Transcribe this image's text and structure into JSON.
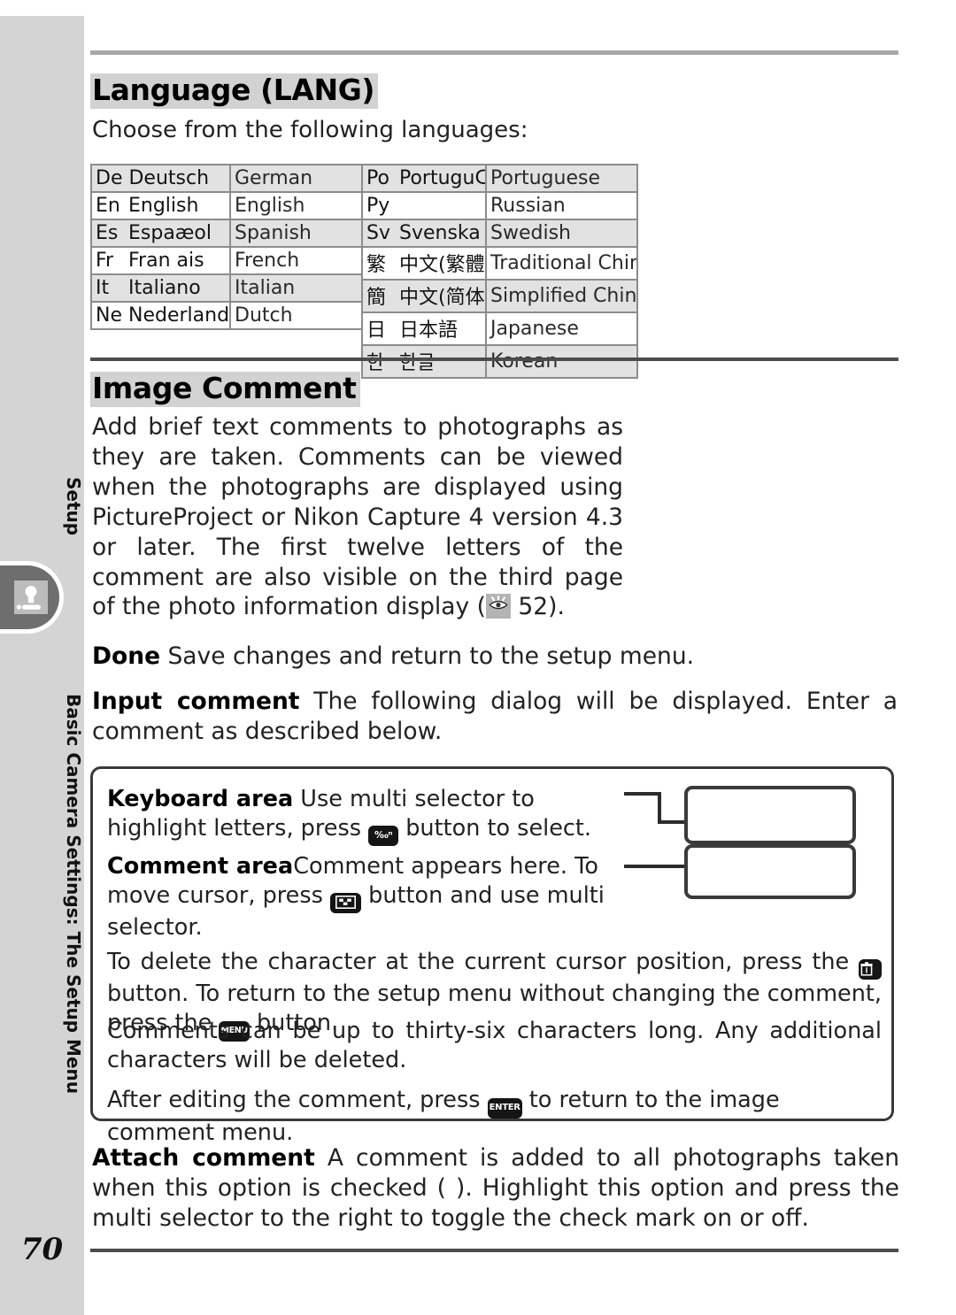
{
  "sidebar": {
    "setup_label": "Setup",
    "chapter_label": "Basic Camera Settings: The Setup Menu",
    "page_number": "70"
  },
  "sections": {
    "language": {
      "title": "Language (LANG)",
      "lead": "Choose from the following languages:",
      "table_left": [
        {
          "code": "De",
          "native": "Deutsch",
          "english": "German"
        },
        {
          "code": "En",
          "native": "English",
          "english": "English"
        },
        {
          "code": "Es",
          "native": "Espaæol",
          "english": "Spanish"
        },
        {
          "code": "Fr",
          "native": "Fran ais",
          "english": "French"
        },
        {
          "code": "It",
          "native": "Italiano",
          "english": "Italian"
        },
        {
          "code": "Ne",
          "native": "Nederlands",
          "english": "Dutch"
        }
      ],
      "table_right": [
        {
          "code": "Po",
          "native": "PortuguŒEs",
          "english": "Portuguese"
        },
        {
          "code": "Py",
          "native": "",
          "english": "Russian"
        },
        {
          "code": "Sv",
          "native": "Svenska",
          "english": "Swedish"
        },
        {
          "code": "繁",
          "native": "中文(繁體)",
          "english": "Traditional Chinese"
        },
        {
          "code": "簡",
          "native": "中文(简体)",
          "english": "Simplified Chinese"
        },
        {
          "code": "日",
          "native": "日本語",
          "english": "Japanese"
        },
        {
          "code": "한",
          "native": "한글",
          "english": "Korean"
        }
      ]
    },
    "image_comment": {
      "title": "Image Comment",
      "body_pre": "Add brief text comments to photographs as they are taken.  Comments can be viewed when the photographs are displayed using PictureProject or Nikon Capture 4 version 4.3 or later.  The first twelve letters of the comment are also visible on the third page of the photo information display (",
      "body_post": " 52).",
      "done_label": "Done",
      "done_text": " Save changes and return to the setup menu.",
      "input_label": "Input comment",
      "input_text": " The following dialog will be displayed.  Enter a comment as described below.",
      "attach_label": "Attach comment",
      "attach_text": " A comment is added to all photographs taken when this option is checked (   ).  Highlight this option and press the multi selector to the right to toggle the check mark on or off."
    },
    "callout": {
      "keyboard_label": "Keyboard area",
      "keyboard_text_pre": " Use multi selector to highlight letters, press ",
      "keyboard_text_post": " button to select.",
      "comment_label": "Comment area",
      "comment_text_pre": "Comment appears here.  To move cursor, press ",
      "comment_text_post": " button and use multi selector.",
      "delete_text_pre": "To delete the character at the current cursor position, press the ",
      "delete_text_mid": " button.  To return to the setup menu without changing the comment, press the ",
      "delete_text_post": " button.",
      "length_text": "Comments can be up to thirty-six characters long.  Any additional characters will be deleted.",
      "after_text_pre": "After editing the comment, press ",
      "after_text_post": " to return to the image comment menu."
    }
  },
  "icons": {
    "eye": "playback-info-icon",
    "qual_button": "‰ⁿ",
    "thumbnail_button": "thumbnail",
    "trash_button": "trash",
    "menu_button": "MENU",
    "enter_button": "ENTER"
  },
  "colors": {
    "sidebar_bg": "#d4d4d4",
    "tab_bg": "#6e6e6e",
    "title_highlight": "#d2d2d2",
    "rule_top": "#a8a8a8",
    "rule_dark": "#4c4c4c",
    "table_border": "#8c8c8c",
    "table_row_shaded": "#e2e2e2"
  }
}
